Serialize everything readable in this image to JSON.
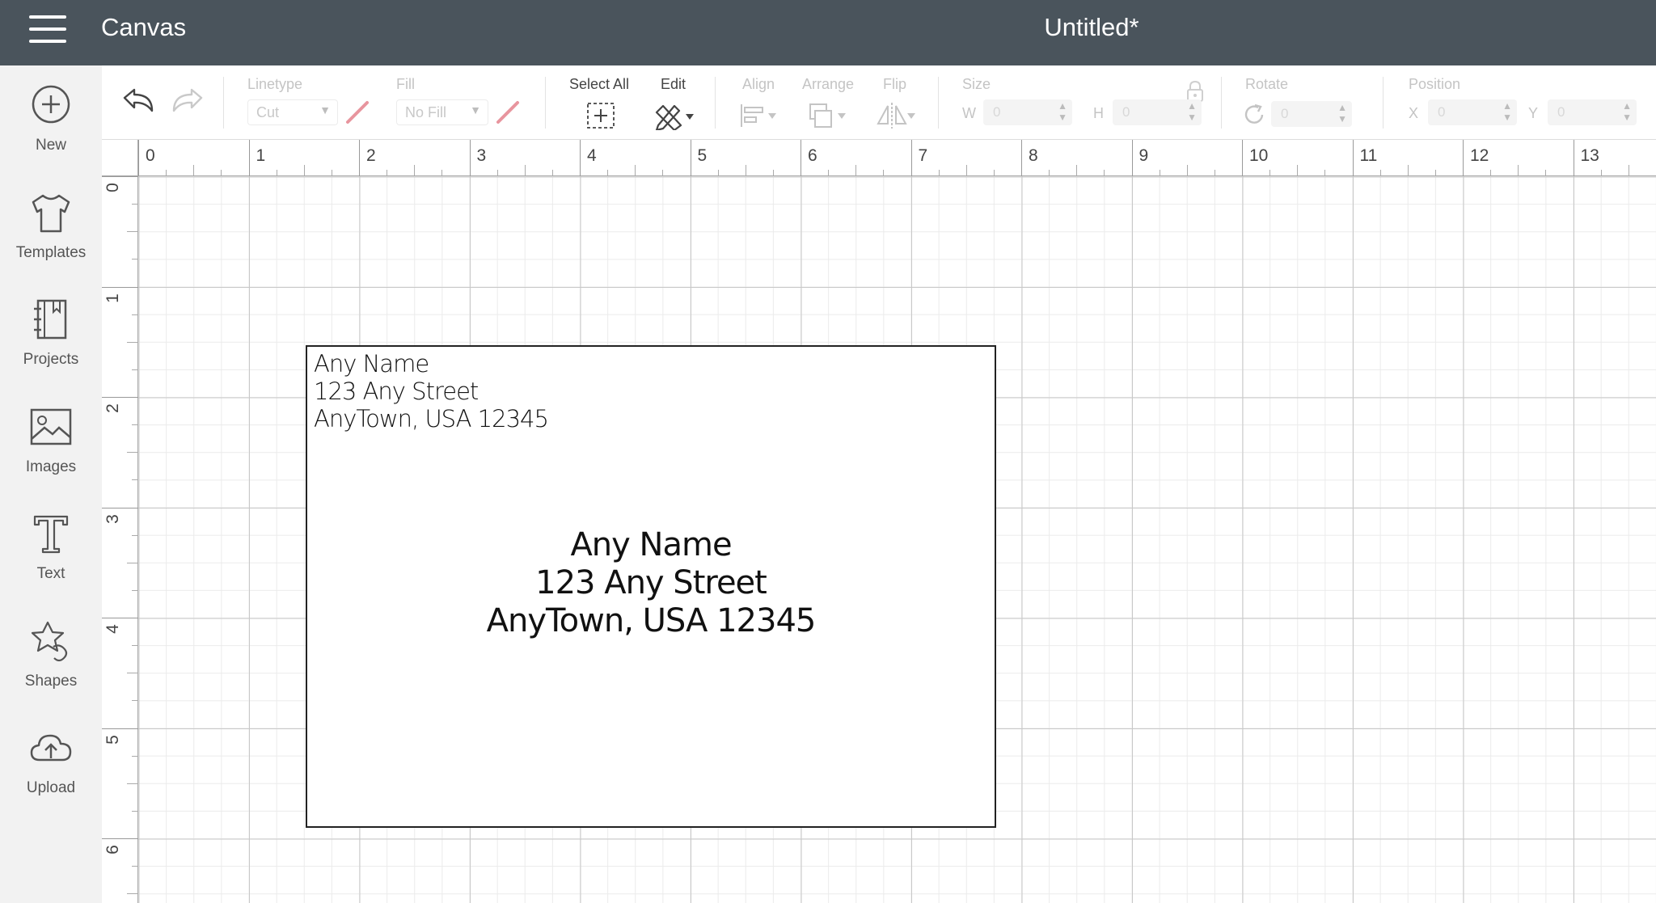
{
  "header": {
    "app_title": "Canvas",
    "doc_title": "Untitled*"
  },
  "sidebar": {
    "items": [
      {
        "label": "New",
        "icon": "plus-circle-icon"
      },
      {
        "label": "Templates",
        "icon": "tshirt-icon"
      },
      {
        "label": "Projects",
        "icon": "notebook-icon"
      },
      {
        "label": "Images",
        "icon": "image-icon"
      },
      {
        "label": "Text",
        "icon": "text-t-icon"
      },
      {
        "label": "Shapes",
        "icon": "shapes-icon"
      },
      {
        "label": "Upload",
        "icon": "cloud-upload-icon"
      }
    ]
  },
  "toolbar": {
    "linetype": {
      "label": "Linetype",
      "value": "Cut"
    },
    "fill": {
      "label": "Fill",
      "value": "No Fill"
    },
    "select_all": {
      "label": "Select All"
    },
    "edit": {
      "label": "Edit"
    },
    "align": {
      "label": "Align"
    },
    "arrange": {
      "label": "Arrange"
    },
    "flip": {
      "label": "Flip"
    },
    "size": {
      "label": "Size",
      "w_label": "W",
      "w_value": "0",
      "h_label": "H",
      "h_value": "0"
    },
    "rotate": {
      "label": "Rotate",
      "value": "0"
    },
    "position": {
      "label": "Position",
      "x_label": "X",
      "x_value": "0",
      "y_label": "Y",
      "y_value": "0"
    }
  },
  "rulers": {
    "horizontal": [
      "0",
      "1",
      "2",
      "3",
      "4",
      "5",
      "6",
      "7",
      "8",
      "9",
      "10",
      "11",
      "12",
      "13"
    ],
    "vertical": [
      "0",
      "1",
      "2",
      "3",
      "4",
      "5",
      "6"
    ]
  },
  "envelope": {
    "return_address": [
      "Any Name",
      "123 Any Street",
      "AnyTown, USA 12345"
    ],
    "recipient_address": [
      "Any Name",
      "123 Any Street",
      "AnyTown, USA 12345"
    ]
  },
  "colors": {
    "header_bg": "#4a545c",
    "sidebar_bg": "#f2f2f2",
    "accent_pink": "#e8959e"
  }
}
